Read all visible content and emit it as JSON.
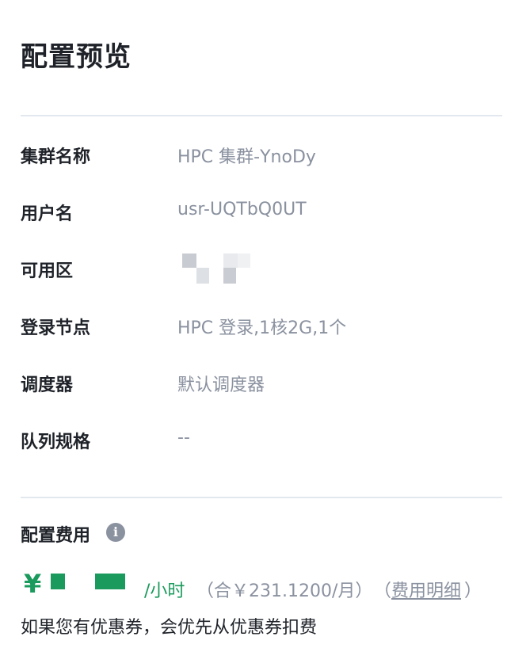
{
  "page": {
    "title": "配置预览"
  },
  "config": {
    "rows": [
      {
        "label": "集群名称",
        "value": "HPC 集群-YnoDy"
      },
      {
        "label": "用户名",
        "value": "usr-UQTbQ0UT"
      },
      {
        "label": "可用区",
        "value": ""
      },
      {
        "label": "登录节点",
        "value": "HPC 登录,1核2G,1个"
      },
      {
        "label": "调度器",
        "value": "默认调度器"
      },
      {
        "label": "队列规格",
        "value": "--"
      }
    ]
  },
  "fee": {
    "title": "配置费用",
    "info_icon": "info-icon",
    "currency": "¥",
    "per_hour": "/小时",
    "monthly": "（合￥231.1200/月）",
    "detail_open": "（",
    "detail_link": "费用明细",
    "detail_close": "）",
    "coupon_note": "如果您有优惠券，会优先从优惠券扣费"
  },
  "colors": {
    "accent": "#1a9a5c",
    "muted": "#8a919f",
    "divider": "#e3e8ee"
  }
}
